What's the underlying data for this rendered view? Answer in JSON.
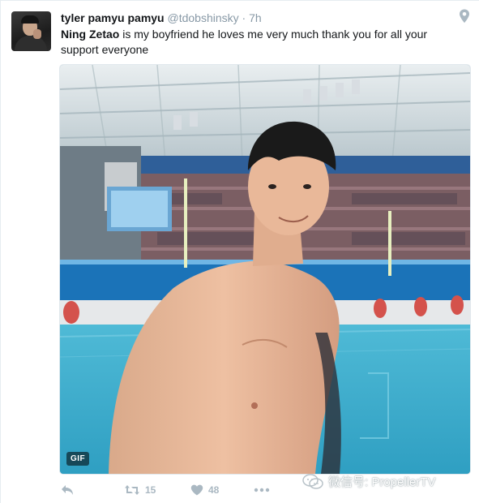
{
  "tweet": {
    "display_name": "tyler pamyu pamyu",
    "handle": "@tdobshinsky",
    "separator": "·",
    "time": "7h",
    "mention": "Ning Zetao",
    "text_rest": " is my boyfriend he loves me very much thank you for all your support everyone",
    "media_badge": "GIF",
    "retweet_count": "15",
    "like_count": "48"
  },
  "icons": {
    "avatar": "profile-photo",
    "location": "location-pin-icon",
    "reply": "reply-arrow-icon",
    "retweet": "retweet-icon",
    "like": "heart-icon",
    "more": "ellipsis-icon",
    "watermark": "wechat-icon"
  },
  "watermark": {
    "text": "微信号: PropellerTV"
  },
  "colors": {
    "name": "#14171a",
    "meta": "#8899a6",
    "action": "#aab8c2",
    "pool": "#3aa8c9"
  }
}
